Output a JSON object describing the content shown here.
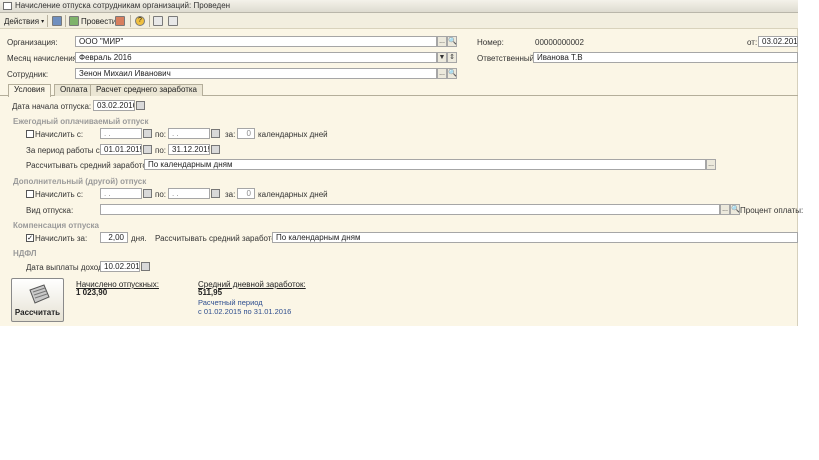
{
  "window": {
    "title": "Начисление отпуска сотрудникам организаций: Проведен"
  },
  "toolbar": {
    "actions_label": "Действия",
    "post_label": "Провести"
  },
  "header": {
    "org_label": "Организация:",
    "org_value": "ООО \"МИР\"",
    "month_label": "Месяц начисления:",
    "month_value": "Февраль 2016",
    "employee_label": "Сотрудник:",
    "employee_value": "Зенон Михаил Иванович",
    "number_label": "Номер:",
    "number_value": "00000000002",
    "date_label": "от:",
    "date_value": "03.02.2016",
    "responsible_label": "Ответственный:",
    "responsible_value": "Иванова Т.В"
  },
  "tabs": [
    "Условия",
    "Оплата",
    "Расчет среднего заработка"
  ],
  "conditions": {
    "start_label": "Дата начала отпуска:",
    "start_value": "03.02.2016",
    "annual": {
      "title": "Ежегодный оплачиваемый отпуск",
      "accrue_label": "Начислить с:",
      "accrue_from": ". .",
      "to_label": "по:",
      "accrue_to": ". .",
      "for_label": "за:",
      "days_value": "0",
      "days_unit": "календарных дней",
      "period_label": "За период работы с:",
      "period_from": "01.01.2015",
      "period_to_label": "по:",
      "period_to": "31.12.2015",
      "avg_label": "Рассчитывать средний заработок:",
      "avg_value": "По календарным дням"
    },
    "additional": {
      "title": "Дополнительный (другой) отпуск",
      "accrue_label": "Начислить с:",
      "accrue_from": ". .",
      "to_label": "по:",
      "accrue_to": ". .",
      "for_label": "за:",
      "days_value": "0",
      "days_unit": "календарных дней",
      "type_label": "Вид отпуска:",
      "type_value": "",
      "percent_label": "Процент оплаты:"
    },
    "compensation": {
      "title": "Компенсация отпуска",
      "accrue_label": "Начислить за:",
      "days_value": "2,00",
      "days_unit": "дня.",
      "avg_label": "Рассчитывать средний заработок:",
      "avg_value": "По календарным дням",
      "checked": true
    },
    "ndfl": {
      "title": "НДФЛ",
      "pay_date_label": "Дата выплаты дохода:",
      "pay_date_value": "10.02.2016"
    }
  },
  "summary": {
    "calc_button": "Рассчитать",
    "accrued_label": "Начислено отпускных:",
    "accrued_value": "1 023,90",
    "avg_label": "Средний дневной заработок:",
    "avg_value": "511,95",
    "period_label": "Расчетный период",
    "period_value": "с 01.02.2015 по 31.01.2016"
  },
  "colors": {
    "background": "#fbf6e6",
    "section_title": "#9a9a9a",
    "link_blue": "#2f4f8f"
  }
}
